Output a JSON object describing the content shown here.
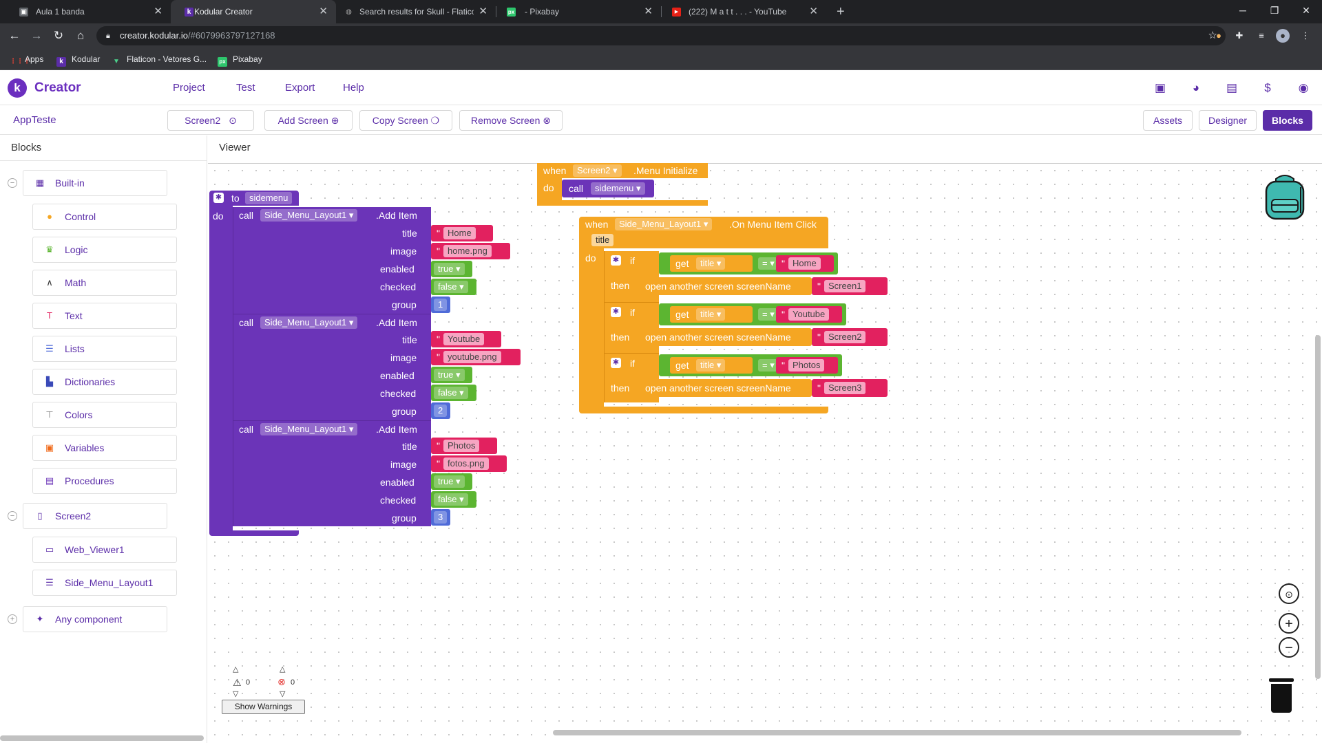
{
  "browser": {
    "tabs": [
      {
        "title": "Aula 1 banda",
        "favicon": "image-icon"
      },
      {
        "title": "Kodular Creator",
        "favicon": "k-icon"
      },
      {
        "title": "Search results for Skull - Flaticon",
        "favicon": "globe-icon"
      },
      {
        "title": "- Pixabay",
        "favicon": "px-icon"
      },
      {
        "title": "(222) M a t t . . . - YouTube",
        "favicon": "youtube-icon"
      }
    ],
    "url_host": "creator.kodular.io",
    "url_path": "/#6079963797127168",
    "bookmarks": [
      {
        "label": "Apps"
      },
      {
        "label": "Kodular"
      },
      {
        "label": "Flaticon - Vetores G..."
      },
      {
        "label": "Pixabay"
      }
    ]
  },
  "app": {
    "brand": "Creator",
    "menu": [
      "Project",
      "Test",
      "Export",
      "Help"
    ],
    "project_name": "AppTeste",
    "screen_selector": "Screen2",
    "add_screen": "Add Screen",
    "copy_screen": "Copy Screen",
    "remove_screen": "Remove Screen",
    "assets": "Assets",
    "designer": "Designer",
    "blocks": "Blocks",
    "accent_color": "#5b2da8"
  },
  "blocks_panel": {
    "title": "Blocks",
    "builtin_label": "Built-in",
    "builtin": [
      {
        "label": "Control",
        "icon": "control-icon"
      },
      {
        "label": "Logic",
        "icon": "logic-icon"
      },
      {
        "label": "Math",
        "icon": "math-icon"
      },
      {
        "label": "Text",
        "icon": "text-icon"
      },
      {
        "label": "Lists",
        "icon": "lists-icon"
      },
      {
        "label": "Dictionaries",
        "icon": "dictionaries-icon"
      },
      {
        "label": "Colors",
        "icon": "colors-icon"
      },
      {
        "label": "Variables",
        "icon": "variables-icon"
      },
      {
        "label": "Procedures",
        "icon": "procedures-icon"
      }
    ],
    "screen_label": "Screen2",
    "components": [
      {
        "label": "Web_Viewer1",
        "icon": "web-viewer-icon"
      },
      {
        "label": "Side_Menu_Layout1",
        "icon": "side-menu-icon"
      }
    ],
    "any_component": "Any component"
  },
  "viewer": {
    "title": "Viewer",
    "proc": {
      "to": "to",
      "name": "sidemenu",
      "do": "do",
      "calls": [
        {
          "title": "Home",
          "image": "home.png",
          "enabled": "true",
          "checked": "false",
          "group": "1"
        },
        {
          "title": "Youtube",
          "image": "youtube.png",
          "enabled": "true",
          "checked": "false",
          "group": "2"
        },
        {
          "title": "Photos",
          "image": "fotos.png",
          "enabled": "true",
          "checked": "false",
          "group": "3"
        }
      ],
      "call_kw": "call",
      "component": "Side_Menu_Layout1",
      "method": ".Add Item",
      "params": [
        "title",
        "image",
        "enabled",
        "checked",
        "group"
      ]
    },
    "init": {
      "when": "when",
      "screen": "Screen2",
      "event": ".Menu Initialize",
      "do": "do",
      "call": "call",
      "proc": "sidemenu"
    },
    "click": {
      "when": "when",
      "component": "Side_Menu_Layout1",
      "event": ".On Menu Item Click",
      "param": "title",
      "do": "do",
      "if": "if",
      "then": "then",
      "get": "get",
      "var": "title",
      "eq": "=",
      "open": "open another screen  screenName",
      "branches": [
        {
          "value": "Home",
          "screen": "Screen1"
        },
        {
          "value": "Youtube",
          "screen": "Screen2"
        },
        {
          "value": "Photos",
          "screen": "Screen3"
        }
      ]
    },
    "warnings_count": "0",
    "errors_count": "0",
    "show_warnings": "Show Warnings"
  }
}
